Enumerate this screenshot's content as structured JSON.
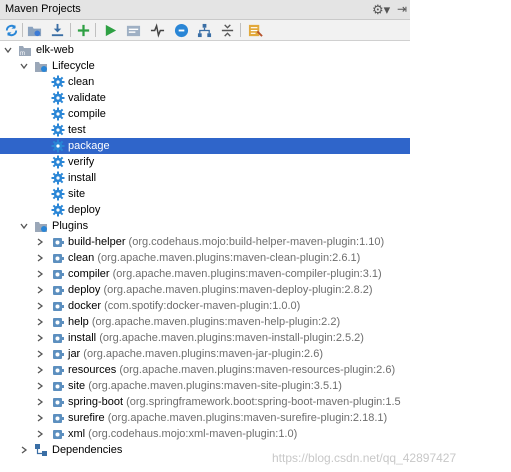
{
  "window": {
    "title": "Maven Projects"
  },
  "toolbar": [
    "reimport-icon",
    "generate-sources-icon",
    "download-icon",
    "add-icon",
    "run-icon",
    "execute-goal-icon",
    "toggle-offline-icon",
    "skip-tests-icon",
    "dependencies-icon",
    "collapse-all-icon",
    "settings-icon"
  ],
  "tree": {
    "project": "elk-web",
    "lifecycle": {
      "label": "Lifecycle",
      "goals": [
        "clean",
        "validate",
        "compile",
        "test",
        "package",
        "verify",
        "install",
        "site",
        "deploy"
      ],
      "selected": "package"
    },
    "plugins": {
      "label": "Plugins",
      "items": [
        {
          "name": "build-helper",
          "coord": "(org.codehaus.mojo:build-helper-maven-plugin:1.10)"
        },
        {
          "name": "clean",
          "coord": "(org.apache.maven.plugins:maven-clean-plugin:2.6.1)"
        },
        {
          "name": "compiler",
          "coord": "(org.apache.maven.plugins:maven-compiler-plugin:3.1)"
        },
        {
          "name": "deploy",
          "coord": "(org.apache.maven.plugins:maven-deploy-plugin:2.8.2)"
        },
        {
          "name": "docker",
          "coord": "(com.spotify:docker-maven-plugin:1.0.0)"
        },
        {
          "name": "help",
          "coord": "(org.apache.maven.plugins:maven-help-plugin:2.2)"
        },
        {
          "name": "install",
          "coord": "(org.apache.maven.plugins:maven-install-plugin:2.5.2)"
        },
        {
          "name": "jar",
          "coord": "(org.apache.maven.plugins:maven-jar-plugin:2.6)"
        },
        {
          "name": "resources",
          "coord": "(org.apache.maven.plugins:maven-resources-plugin:2.6)"
        },
        {
          "name": "site",
          "coord": "(org.apache.maven.plugins:maven-site-plugin:3.5.1)"
        },
        {
          "name": "spring-boot",
          "coord": "(org.springframework.boot:spring-boot-maven-plugin:1.5"
        },
        {
          "name": "surefire",
          "coord": "(org.apache.maven.plugins:maven-surefire-plugin:2.18.1)"
        },
        {
          "name": "xml",
          "coord": "(org.codehaus.mojo:xml-maven-plugin:1.0)"
        }
      ]
    },
    "dependencies": {
      "label": "Dependencies"
    }
  },
  "watermark": "https://blog.csdn.net/qq_42897427",
  "colors": {
    "selection": "#2f65ca",
    "goal_icon": "#2a86d6",
    "plugin_icon": "#5c8fbf"
  }
}
